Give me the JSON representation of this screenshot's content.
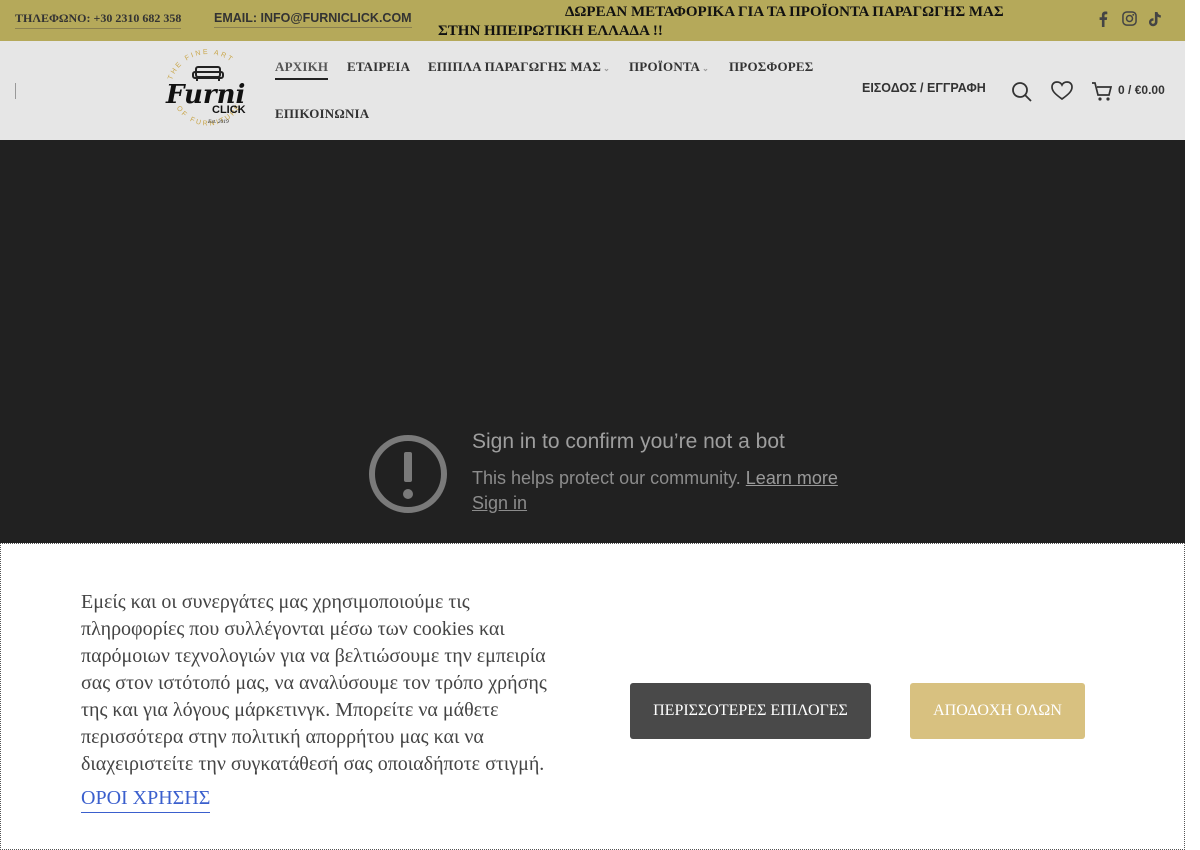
{
  "topbar": {
    "phone": "ΤΗΛΕΦΩΝΟ: +30 2310 682 358",
    "email": "EMAIL: INFO@FURNICLICK.COM",
    "promo_line1": "ΔΩΡΕΑΝ ΜΕΤΑΦΟΡΙΚΑ ΓΙΑ ΤΑ ΠΡΟΪΟΝΤΑ ΠΑΡΑΓΩΓΗΣ ΜΑΣ",
    "promo_line2": "ΣΤΗΝ ΗΠΕΙΡΩΤΙΚΗ ΕΛΛΑΔΑ !!",
    "social_icons": [
      "facebook-icon",
      "instagram-icon",
      "tiktok-icon"
    ],
    "background_color": "#b5a95a"
  },
  "logo": {
    "name_top": "Furni",
    "name_bottom": "CLICK",
    "arc_top": "THE FINE ART",
    "arc_bottom": "OF FURNITURE",
    "est": "Est. 2019"
  },
  "nav": {
    "items": [
      {
        "label": "ΑΡΧΙΚΗ",
        "active": true
      },
      {
        "label": "ΕΤΑΙΡΕΙΑ"
      },
      {
        "label": "ΕΠΙΠΛΑ ΠΑΡΑΓΩΓΗΣ ΜΑΣ",
        "dropdown": true
      },
      {
        "label": "ΠΡΟΪΟΝΤΑ",
        "dropdown": true
      },
      {
        "label": "ΠΡΟΣΦΟΡΕΣ"
      },
      {
        "label": "ΕΠΙΚΟΙΝΩΝΙΑ"
      }
    ]
  },
  "header_right": {
    "login_label": "ΕΙΣΟΔΟΣ / ΕΓΓΡΑΦΗ",
    "cart_count": "0",
    "cart_separator": "/",
    "cart_total": "€0.00"
  },
  "video": {
    "title": "Sign in to confirm you’re not a bot",
    "subtitle": "This helps protect our community.",
    "learn_more": "Learn more",
    "sign_in": "Sign in"
  },
  "cookie": {
    "message": "Εμείς και οι συνεργάτες μας χρησιμοποιούμε τις πληροφορίες που συλλέγονται μέσω των cookies και παρόμοιων τεχνολογιών για να βελτιώσουμε την εμπειρία σας στον ιστότοπό μας, να αναλύσουμε τον τρόπο χρήσης της και για λόγους μάρκετινγκ. Μπορείτε να μάθετε περισσότερα στην πολιτική απορρήτου μας και να διαχειριστείτε την συγκατάθεσή σας οποιαδήποτε στιγμή.",
    "terms_link": "ΟΡΟΙ ΧΡΗΣΗΣ",
    "more_options": "ΠΕΡΙΣΣΟΤΕΡΕΣ ΕΠΙΛΟΓΕΣ",
    "accept_all": "ΑΠΟΔΟΧΗ ΟΛΩΝ",
    "accept_color": "#d8c180",
    "more_color": "#494949"
  }
}
